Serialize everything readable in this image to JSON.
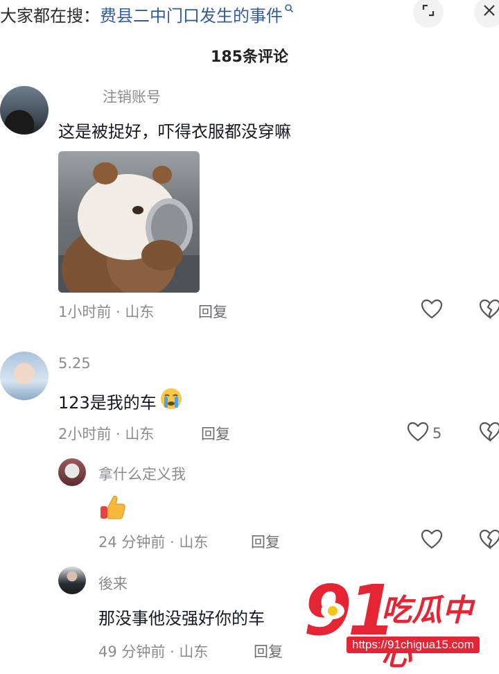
{
  "search": {
    "prefix": "大家都在搜：",
    "query": "费县二中门口发生的事件"
  },
  "header": {
    "comment_count": "185条评论"
  },
  "comments": [
    {
      "username": "注销账号",
      "text": "这是被捉好，吓得衣服都没穿嘛",
      "time_location": "1小时前 · 山东",
      "reply_label": "回复"
    },
    {
      "username": "5.25",
      "text": "123是我的车",
      "time_location": "2小时前 · 山东",
      "reply_label": "回复",
      "likes": "5"
    }
  ],
  "replies": [
    {
      "username": "拿什么定义我",
      "time_location": "24 分钟前 · 山东",
      "reply_label": "回复"
    },
    {
      "username": "後来",
      "text": "那没事他没强好你的车",
      "time_location": "49 分钟前 · 山东",
      "reply_label": "回复"
    }
  ],
  "watermark": {
    "number": "91",
    "name": "吃瓜中心",
    "url": "https://91chigua15.com"
  },
  "colors": {
    "accent_link": "#2f5d9c",
    "watermark_red": "#e52534"
  }
}
